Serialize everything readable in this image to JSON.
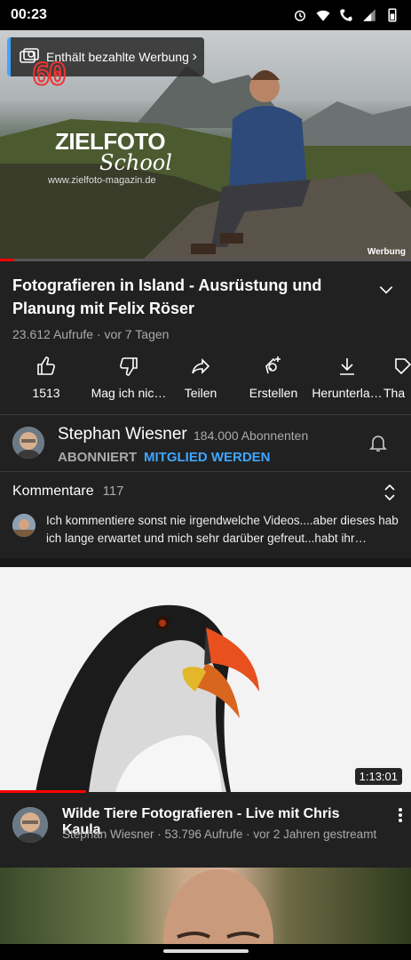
{
  "status": {
    "time": "00:23"
  },
  "player": {
    "ad_chip_label": "Enthält bezahlte Werbung",
    "overlay_number": "60",
    "logo_line1": "ZIELFOTO",
    "logo_line2": "School",
    "logo_url": "www.zielfoto-magazin.de",
    "werbung_label": "Werbung",
    "progress": 0.035
  },
  "video": {
    "title": "Fotografieren in Island - Ausrüstung und Planung mit Felix Röser",
    "views": "23.612 Aufrufe",
    "age": "vor 7 Tagen",
    "meta_separator": " · "
  },
  "actions": [
    {
      "label": "1513",
      "icon": "thumbs-up-icon"
    },
    {
      "label": "Mag ich nic…",
      "icon": "thumbs-down-icon"
    },
    {
      "label": "Teilen",
      "icon": "share-icon"
    },
    {
      "label": "Erstellen",
      "icon": "create-icon"
    },
    {
      "label": "Herunterla…",
      "icon": "download-icon"
    },
    {
      "label": "Tha",
      "icon": "thanks-icon"
    }
  ],
  "channel": {
    "name": "Stephan Wiesner",
    "subscribers": "184.000 Abonnenten",
    "subscribed_label": "ABONNIERT",
    "member_label": "MITGLIED WERDEN"
  },
  "comments": {
    "heading": "Kommentare",
    "count": "117",
    "preview": "Ich kommentiere sonst nie irgendwelche Videos....aber dieses hab ich lange erwartet und mich sehr darüber gefreut...habt ihr…"
  },
  "next_video": {
    "duration": "1:13:01",
    "title": "Wilde Tiere Fotografieren - Live mit Chris Kaula",
    "meta": "Stephan Wiesner · 53.796 Aufrufe · vor 2 Jahren gestreamt",
    "watched_progress": 0.21
  },
  "colors": {
    "accent": "#3ea6ff",
    "progress_red": "#ff0000",
    "background": "#212121"
  }
}
